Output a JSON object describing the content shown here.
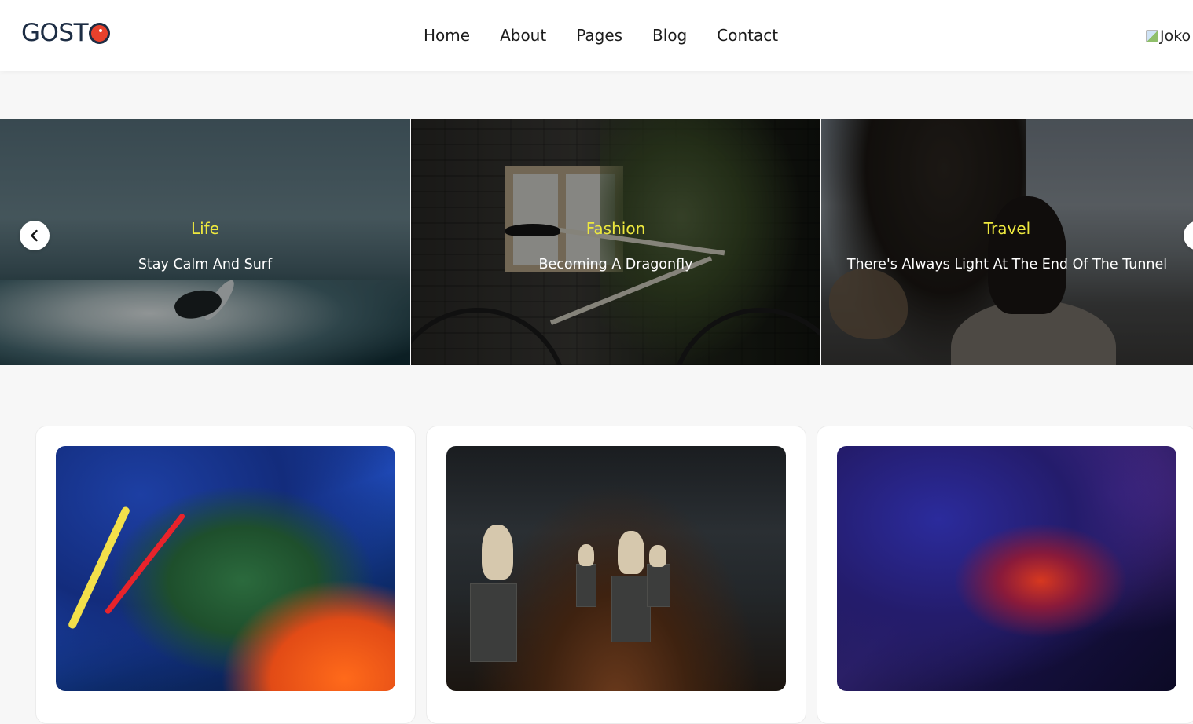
{
  "brand": {
    "logo_text": "GOST",
    "accent_color": "#e8412c",
    "text_color": "#1d2d44"
  },
  "nav": {
    "items": [
      {
        "label": "Home"
      },
      {
        "label": "About"
      },
      {
        "label": "Pages"
      },
      {
        "label": "Blog"
      },
      {
        "label": "Contact"
      }
    ]
  },
  "user": {
    "image_alt_text": "Joko",
    "icon": "broken-image-icon"
  },
  "slider": {
    "prev_icon": "chevron-left-icon",
    "next_icon": "chevron-right-icon",
    "category_color": "#ede83e",
    "slides": [
      {
        "category": "Life",
        "title": "Stay Calm And Surf"
      },
      {
        "category": "Fashion",
        "title": "Becoming A Dragonfly"
      },
      {
        "category": "Travel",
        "title": "There's Always Light At The End Of The Tunnel"
      }
    ]
  },
  "cards": [
    {
      "image": "abstract-paint-image"
    },
    {
      "image": "museum-gallery-image"
    },
    {
      "image": "abstract-galaxy-image"
    }
  ]
}
